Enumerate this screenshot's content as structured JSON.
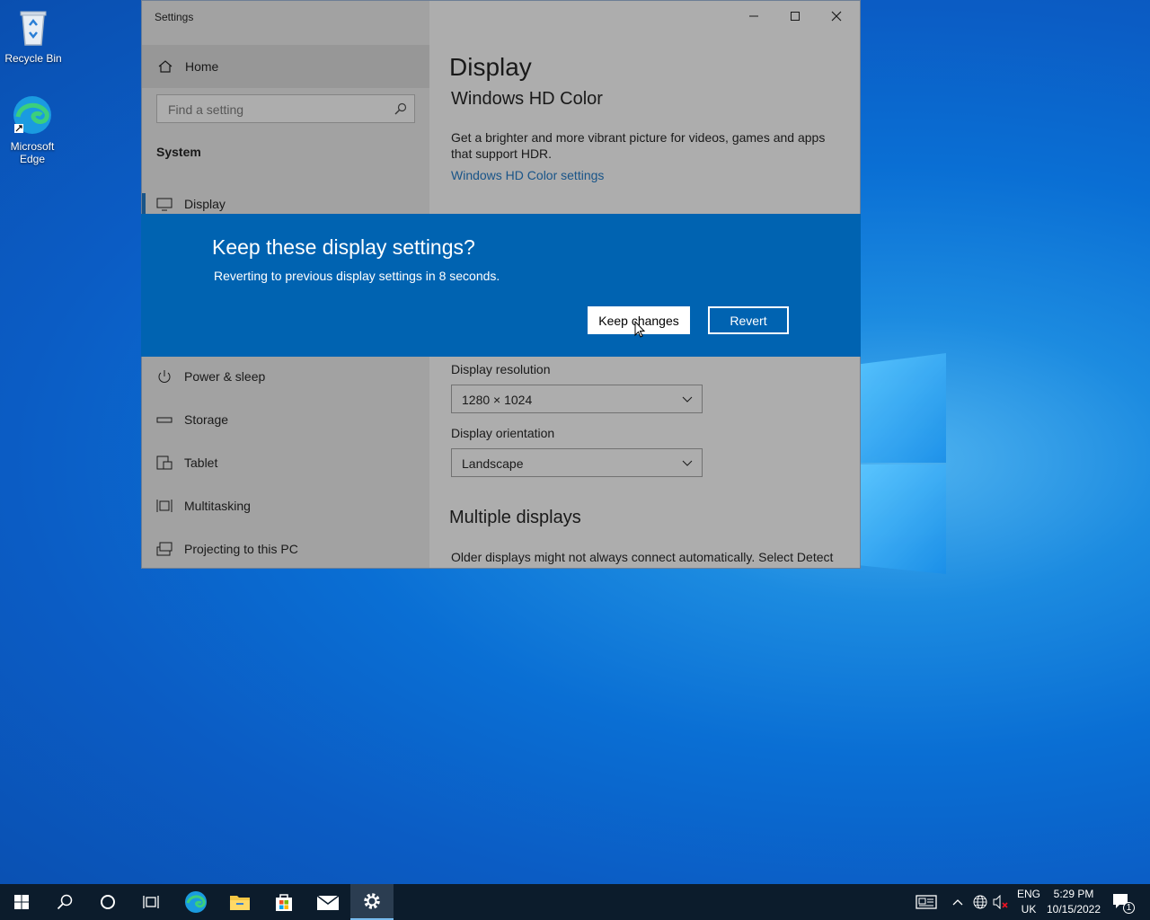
{
  "desktop": {
    "icons": [
      {
        "label": "Recycle Bin"
      },
      {
        "label": "Microsoft Edge"
      }
    ]
  },
  "window": {
    "title": "Settings",
    "sidebar": {
      "home_label": "Home",
      "search_placeholder": "Find a setting",
      "section_label": "System",
      "items": [
        {
          "label": "Display",
          "icon": "monitor-icon",
          "selected": true
        },
        {
          "label": "Power & sleep",
          "icon": "power-icon"
        },
        {
          "label": "Storage",
          "icon": "storage-icon"
        },
        {
          "label": "Tablet",
          "icon": "tablet-icon"
        },
        {
          "label": "Multitasking",
          "icon": "multitasking-icon"
        },
        {
          "label": "Projecting to this PC",
          "icon": "projecting-icon"
        }
      ]
    },
    "main": {
      "page_title": "Display",
      "hdr_heading": "Windows HD Color",
      "hdr_description": "Get a brighter and more vibrant picture for videos, games and apps that support HDR.",
      "hdr_link": "Windows HD Color settings",
      "resolution_label": "Display resolution",
      "resolution_value": "1280 × 1024",
      "orientation_label": "Display orientation",
      "orientation_value": "Landscape",
      "multiple_heading": "Multiple displays",
      "multiple_text": "Older displays might not always connect automatically. Select Detect"
    }
  },
  "dialog": {
    "title": "Keep these display settings?",
    "message": "Reverting to previous display settings in  8 seconds.",
    "keep_label": "Keep changes",
    "revert_label": "Revert",
    "accent": "#0063b1"
  },
  "taskbar": {
    "apps": [
      "start-icon",
      "search-icon",
      "cortana-icon",
      "task-view-icon",
      "edge-icon",
      "file-explorer-icon",
      "store-icon",
      "mail-icon",
      "settings-icon"
    ],
    "lang_primary": "ENG",
    "lang_secondary": "UK",
    "time": "5:29 PM",
    "date": "10/15/2022",
    "notification_count": "1"
  }
}
